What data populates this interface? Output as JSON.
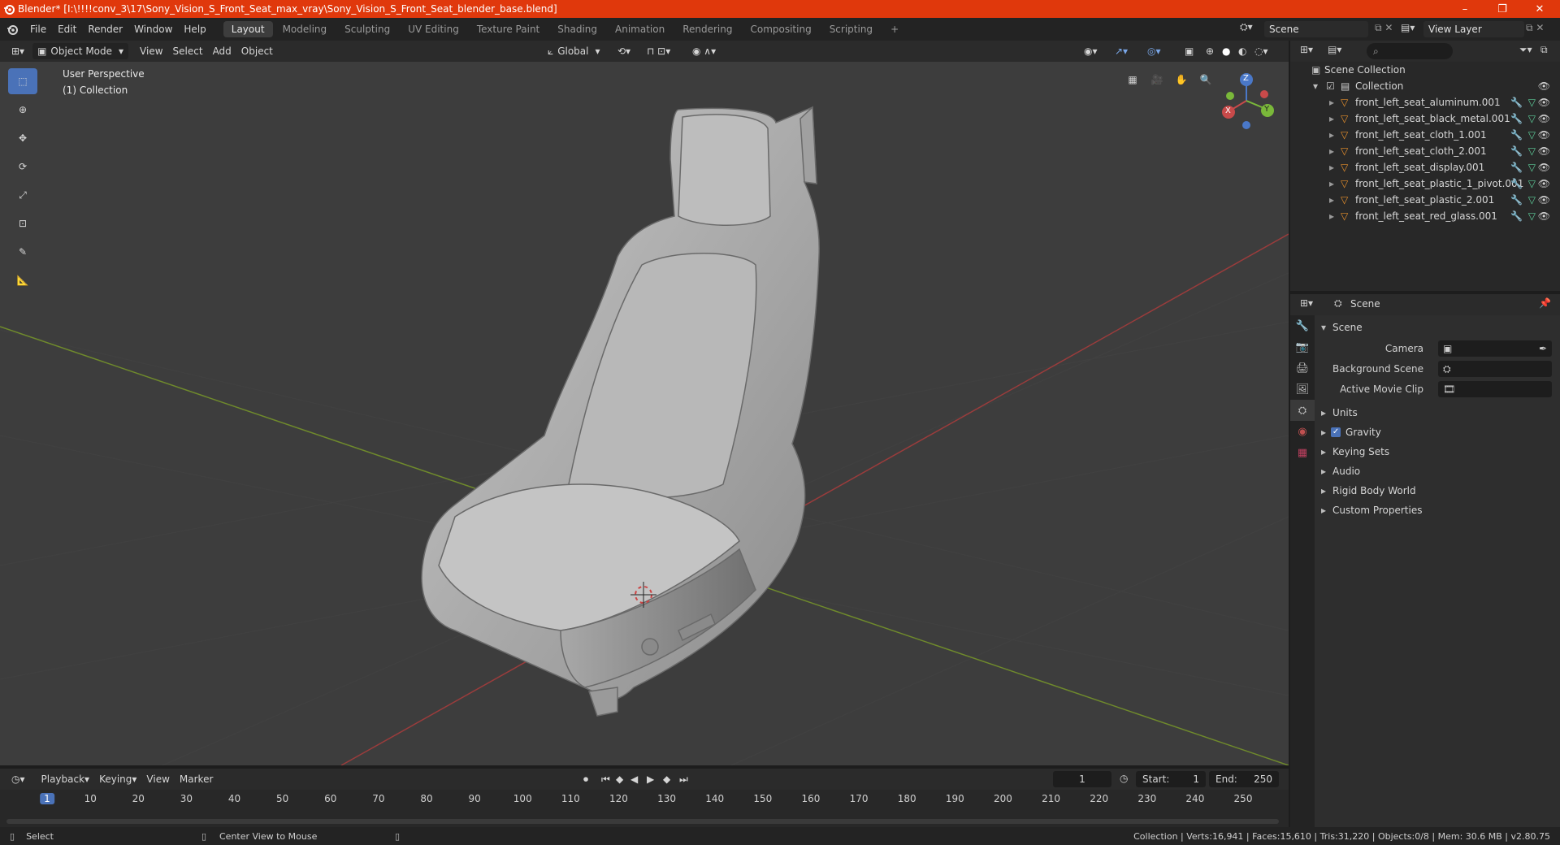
{
  "window": {
    "title": "Blender* [I:\\!!!!conv_3\\17\\Sony_Vision_S_Front_Seat_max_vray\\Sony_Vision_S_Front_Seat_blender_base.blend]",
    "accent_color": "#e0380c"
  },
  "menu": {
    "items": [
      "File",
      "Edit",
      "Render",
      "Window",
      "Help"
    ]
  },
  "workspaces": [
    "Layout",
    "Modeling",
    "Sculpting",
    "UV Editing",
    "Texture Paint",
    "Shading",
    "Animation",
    "Rendering",
    "Compositing",
    "Scripting"
  ],
  "active_workspace": "Layout",
  "scene_selector": "Scene",
  "view_layer": "View Layer",
  "viewport_header": {
    "mode": "Object Mode",
    "menus": [
      "View",
      "Select",
      "Add",
      "Object"
    ],
    "orientation": "Global"
  },
  "viewport": {
    "perspective": "User Perspective",
    "collection": "(1) Collection",
    "gizmo": {
      "x": "X",
      "y": "Y",
      "z": "Z"
    },
    "background": "#3d3d3d"
  },
  "tools": [
    "select-box",
    "cursor",
    "move",
    "rotate",
    "scale",
    "transform",
    "annotate",
    "measure"
  ],
  "outliner": {
    "root": "Scene Collection",
    "collection": "Collection",
    "objects": [
      "front_left_seat_aluminum.001",
      "front_left_seat_black_metal.001",
      "front_left_seat_cloth_1.001",
      "front_left_seat_cloth_2.001",
      "front_left_seat_display.001",
      "front_left_seat_plastic_1_pivot.001",
      "front_left_seat_plastic_2.001",
      "front_left_seat_red_glass.001"
    ]
  },
  "properties": {
    "context": "Scene",
    "section": "Scene",
    "fields": [
      {
        "label": "Camera",
        "value": ""
      },
      {
        "label": "Background Scene",
        "value": ""
      },
      {
        "label": "Active Movie Clip",
        "value": ""
      }
    ],
    "panels": [
      "Units",
      "Gravity",
      "Keying Sets",
      "Audio",
      "Rigid Body World",
      "Custom Properties"
    ],
    "gravity_enabled": true
  },
  "timeline": {
    "menus": [
      "Playback",
      "Keying",
      "View",
      "Marker"
    ],
    "current_frame": "1",
    "start_label": "Start:",
    "start": "1",
    "end_label": "End:",
    "end": "250",
    "ticks": [
      "1",
      "10",
      "20",
      "30",
      "40",
      "50",
      "60",
      "70",
      "80",
      "90",
      "100",
      "110",
      "120",
      "130",
      "140",
      "150",
      "160",
      "170",
      "180",
      "190",
      "200",
      "210",
      "220",
      "230",
      "240",
      "250"
    ]
  },
  "statusbar": {
    "left": "Select",
    "middle": "Center View to Mouse",
    "stats": "Collection | Verts:16,941 | Faces:15,610 | Tris:31,220 | Objects:0/8 | Mem: 30.6 MB | v2.80.75"
  }
}
